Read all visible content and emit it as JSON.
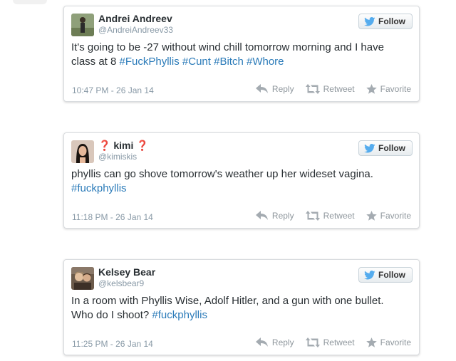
{
  "colors": {
    "hashtag": "#2b7bb9",
    "twitter_blue": "#55acee",
    "meta_gray": "#8899a6"
  },
  "icons": {
    "follow": "twitter-bird-icon",
    "reply": "reply-arrow-icon",
    "retweet": "retweet-icon",
    "favorite": "star-icon"
  },
  "tweets": [
    {
      "display_name": "Andrei Andreev",
      "handle": "@AndreiAndreev33",
      "follow_label": "Follow",
      "text_segments": [
        {
          "text": "It's going to be -27 without wind chill tomorrow morning and I have class at 8 ",
          "hashtag": false
        },
        {
          "text": "#FuckPhyllis",
          "hashtag": true
        },
        {
          "text": " ",
          "hashtag": false
        },
        {
          "text": "#Cunt",
          "hashtag": true
        },
        {
          "text": " ",
          "hashtag": false
        },
        {
          "text": "#Bitch",
          "hashtag": true
        },
        {
          "text": " ",
          "hashtag": false
        },
        {
          "text": "#Whore",
          "hashtag": true
        }
      ],
      "timestamp": "10:47 PM - 26 Jan 14",
      "reply_label": "Reply",
      "retweet_label": "Retweet",
      "favorite_label": "Favorite"
    },
    {
      "display_name": "❓ kimi ❓",
      "handle": "@kimiskis",
      "follow_label": "Follow",
      "text_segments": [
        {
          "text": "phyllis can go shove tomorrow's weather up her wideset vagina. ",
          "hashtag": false
        },
        {
          "text": "#fuckphyllis",
          "hashtag": true
        }
      ],
      "timestamp": "11:18 PM - 26 Jan 14",
      "reply_label": "Reply",
      "retweet_label": "Retweet",
      "favorite_label": "Favorite"
    },
    {
      "display_name": "Kelsey Bear",
      "handle": "@kelsbear9",
      "follow_label": "Follow",
      "text_segments": [
        {
          "text": "In a room with Phyllis Wise, Adolf Hitler, and a gun with one bullet. Who do I shoot? ",
          "hashtag": false
        },
        {
          "text": "#fuckphyllis",
          "hashtag": true
        }
      ],
      "timestamp": "11:25 PM - 26 Jan 14",
      "reply_label": "Reply",
      "retweet_label": "Retweet",
      "favorite_label": "Favorite"
    }
  ]
}
